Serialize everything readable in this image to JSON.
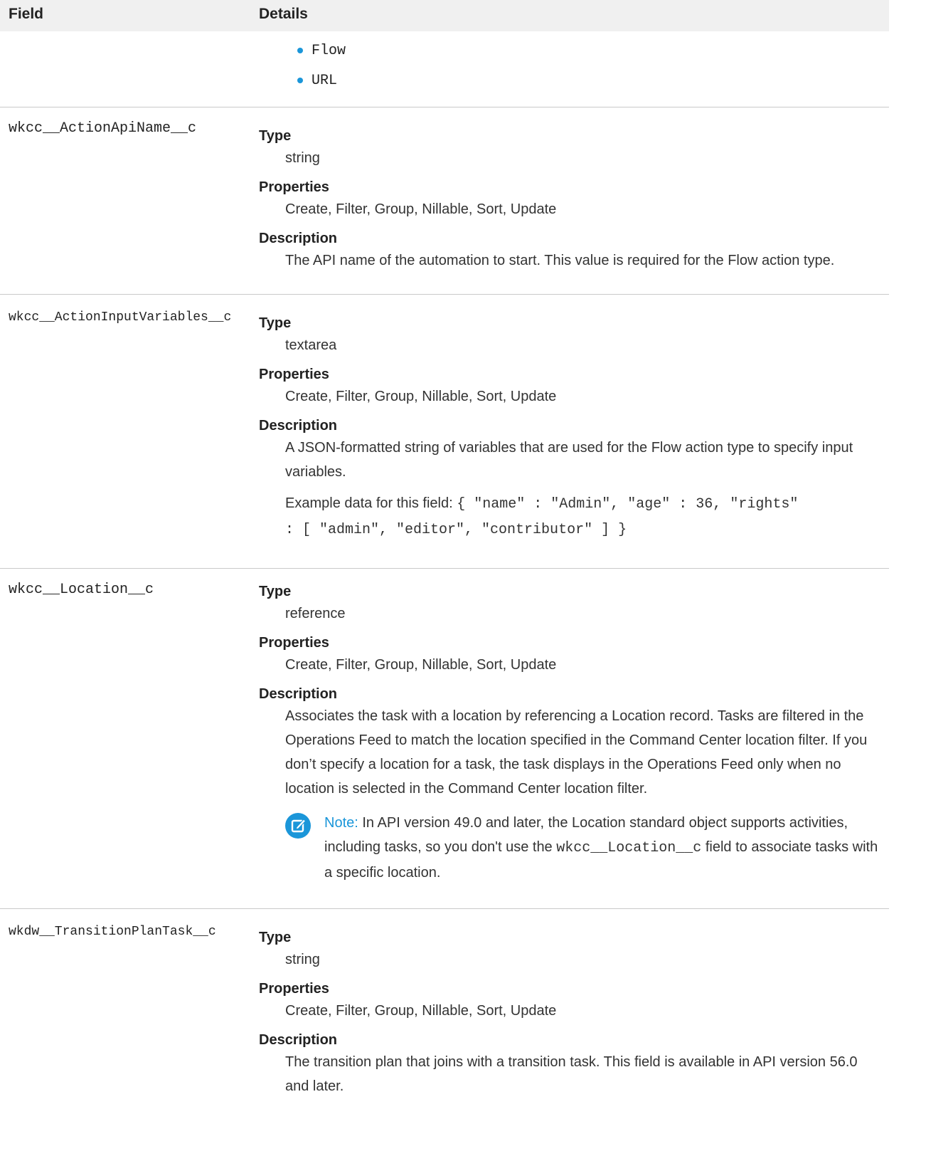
{
  "header": {
    "field": "Field",
    "details": "Details"
  },
  "top_bullets": [
    "Flow",
    "URL"
  ],
  "rows": [
    {
      "field": "wkcc__ActionApiName__c",
      "type_label": "Type",
      "type": "string",
      "properties_label": "Properties",
      "properties": "Create, Filter, Group, Nillable, Sort, Update",
      "description_label": "Description",
      "description": "The API name of the automation to start. This value is required for the Flow action type."
    },
    {
      "field": "wkcc__ActionInputVariables__c",
      "type_label": "Type",
      "type": "textarea",
      "properties_label": "Properties",
      "properties": "Create, Filter, Group, Nillable, Sort, Update",
      "description_label": "Description",
      "description": "A JSON-formatted string of variables that are used for the Flow action type to specify input variables.",
      "example_prefix": "Example data for this field:",
      "example_code_line1": "{ \"name\" : \"Admin\", \"age\" : 36, \"rights\"",
      "example_code_line2": ": [ \"admin\", \"editor\", \"contributor\" ] }"
    },
    {
      "field": "wkcc__Location__c",
      "type_label": "Type",
      "type": "reference",
      "properties_label": "Properties",
      "properties": "Create, Filter, Group, Nillable, Sort, Update",
      "description_label": "Description",
      "description": "Associates the task with a location by referencing a Location record. Tasks are filtered in the Operations Feed to match the location specified in the Command Center location filter. If you don’t specify a location for a task, the task displays in the Operations Feed only when no location is selected in the Command Center location filter.",
      "note_label": "Note:",
      "note_text_before": "In API version 49.0 and later, the Location standard object supports activities, including tasks, so you don't use the",
      "note_code": "wkcc__Location__c",
      "note_text_after": "field to associate tasks with a specific location."
    },
    {
      "field": "wkdw__TransitionPlanTask__c",
      "type_label": "Type",
      "type": "string",
      "properties_label": "Properties",
      "properties": "Create, Filter, Group, Nillable, Sort, Update",
      "description_label": "Description",
      "description": "The transition plan that joins with a transition task. This field is available in API version 56.0 and later."
    }
  ],
  "colors": {
    "accent": "#1b96d9",
    "header_bg": "#f0f0f0",
    "divider": "#c9c9c9"
  },
  "icons": {
    "note": "note-edit-icon"
  }
}
